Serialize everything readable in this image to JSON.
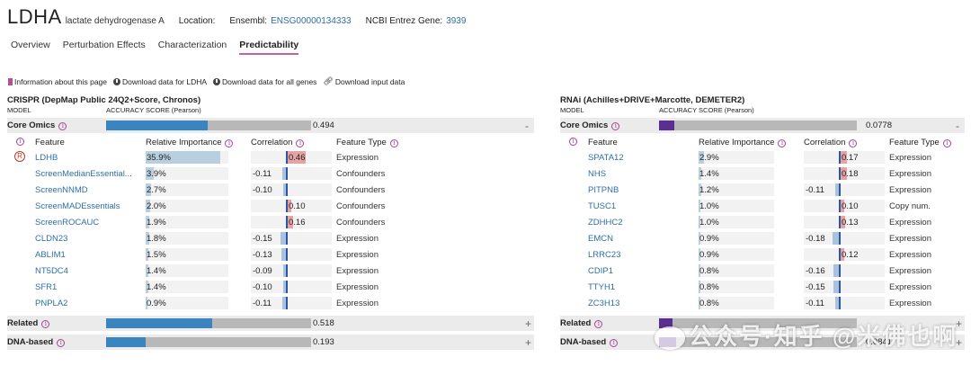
{
  "header": {
    "symbol": "LDHA",
    "full_name": "lactate dehydrogenase A",
    "location_label": "Location:",
    "ensembl_label": "Ensembl:",
    "ensembl_id": "ENSG00000134333",
    "entrez_label": "NCBI Entrez Gene:",
    "entrez_id": "3939"
  },
  "tabs": [
    "Overview",
    "Perturbation Effects",
    "Characterization",
    "Predictability"
  ],
  "active_tab": "Predictability",
  "downloads": {
    "info": "Information about this page",
    "ldha": "Download data for LDHA",
    "all_genes": "Download data for all genes",
    "input": "Download input data"
  },
  "panels": [
    {
      "title": "CRISPR (DepMap Public 24Q2+Score, Chronos)",
      "model_label": "MODEL",
      "accuracy_label": "ACCURACY SCORE (Pearson)",
      "feature_header": "Feature",
      "importance_header": "Relative Importance",
      "correlation_header": "Correlation",
      "type_header": "Feature Type",
      "core": {
        "label": "Core Omics",
        "value": "0.494",
        "score": 0.494,
        "toggle": "-"
      },
      "features": [
        {
          "name": "LDHB",
          "importance": "35.9%",
          "imp": 35.9,
          "corr": "0.46",
          "r": 0.46,
          "type": "Expression",
          "rank": "R"
        },
        {
          "name": "ScreenMedianEssential...",
          "importance": "3.9%",
          "imp": 3.9,
          "corr": "-0.11",
          "r": -0.11,
          "type": "Confounders"
        },
        {
          "name": "ScreenNNMD",
          "importance": "2.7%",
          "imp": 2.7,
          "corr": "-0.10",
          "r": -0.1,
          "type": "Confounders"
        },
        {
          "name": "ScreenMADEssentials",
          "importance": "2.0%",
          "imp": 2.0,
          "corr": "0.10",
          "r": 0.1,
          "type": "Confounders"
        },
        {
          "name": "ScreenROCAUC",
          "importance": "1.9%",
          "imp": 1.9,
          "corr": "0.16",
          "r": 0.16,
          "type": "Confounders"
        },
        {
          "name": "CLDN23",
          "importance": "1.8%",
          "imp": 1.8,
          "corr": "-0.15",
          "r": -0.15,
          "type": "Expression"
        },
        {
          "name": "ABLIM1",
          "importance": "1.5%",
          "imp": 1.5,
          "corr": "-0.13",
          "r": -0.13,
          "type": "Expression"
        },
        {
          "name": "NT5DC4",
          "importance": "1.4%",
          "imp": 1.4,
          "corr": "-0.09",
          "r": -0.09,
          "type": "Expression"
        },
        {
          "name": "SFR1",
          "importance": "1.4%",
          "imp": 1.4,
          "corr": "-0.10",
          "r": -0.1,
          "type": "Expression"
        },
        {
          "name": "PNPLA2",
          "importance": "0.9%",
          "imp": 0.9,
          "corr": "-0.11",
          "r": -0.11,
          "type": "Expression"
        }
      ],
      "related": {
        "label": "Related",
        "value": "0.518",
        "score": 0.518,
        "toggle": "+"
      },
      "dna": {
        "label": "DNA-based",
        "value": "0.193",
        "score": 0.193,
        "toggle": "+"
      }
    },
    {
      "title": "RNAi (Achilles+DRIVE+Marcotte, DEMETER2)",
      "model_label": "MODEL",
      "accuracy_label": "ACCURACY SCORE (Pearson)",
      "feature_header": "Feature",
      "importance_header": "Relative Importance",
      "correlation_header": "Correlation",
      "type_header": "Feature Type",
      "core": {
        "label": "Core Omics",
        "value": "0.0778",
        "score": 0.0778,
        "toggle": "-"
      },
      "features": [
        {
          "name": "SPATA12",
          "importance": "2.9%",
          "imp": 2.9,
          "corr": "0.17",
          "r": 0.17,
          "type": "Expression"
        },
        {
          "name": "NHS",
          "importance": "1.4%",
          "imp": 1.4,
          "corr": "0.18",
          "r": 0.18,
          "type": "Expression"
        },
        {
          "name": "PITPNB",
          "importance": "1.2%",
          "imp": 1.2,
          "corr": "-0.11",
          "r": -0.11,
          "type": "Expression"
        },
        {
          "name": "TUSC1",
          "importance": "1.0%",
          "imp": 1.0,
          "corr": "0.10",
          "r": 0.1,
          "type": "Copy num."
        },
        {
          "name": "ZDHHC2",
          "importance": "1.0%",
          "imp": 1.0,
          "corr": "0.13",
          "r": 0.13,
          "type": "Expression"
        },
        {
          "name": "EMCN",
          "importance": "0.9%",
          "imp": 0.9,
          "corr": "-0.18",
          "r": -0.18,
          "type": "Expression"
        },
        {
          "name": "LRRC23",
          "importance": "0.9%",
          "imp": 0.9,
          "corr": "0.12",
          "r": 0.12,
          "type": "Expression"
        },
        {
          "name": "CDIP1",
          "importance": "0.8%",
          "imp": 0.8,
          "corr": "-0.16",
          "r": -0.16,
          "type": "Expression"
        },
        {
          "name": "TTYH1",
          "importance": "0.8%",
          "imp": 0.8,
          "corr": "-0.15",
          "r": -0.15,
          "type": "Expression"
        },
        {
          "name": "ZC3H13",
          "importance": "0.8%",
          "imp": 0.8,
          "corr": "-0.11",
          "r": -0.11,
          "type": "Expression"
        }
      ],
      "related": {
        "label": "Related",
        "value": "",
        "score": 0.07,
        "toggle": "+"
      },
      "dna": {
        "label": "DNA-based",
        "value": "0.0841",
        "score": 0.0841,
        "toggle": "+"
      }
    }
  ],
  "colors": {
    "crispr_bar": "#3a84bf",
    "rnai_bar": "#5b2e91",
    "track": "#b8b8b8",
    "positive_corr": "#e6a3a3",
    "negative_corr": "#a9c3dc",
    "importance_fill": "#b8cfe0",
    "tab_underline": "#c462a4",
    "link": "#2f6ea6"
  },
  "watermark": "公众号·知乎 @米佛也啊"
}
